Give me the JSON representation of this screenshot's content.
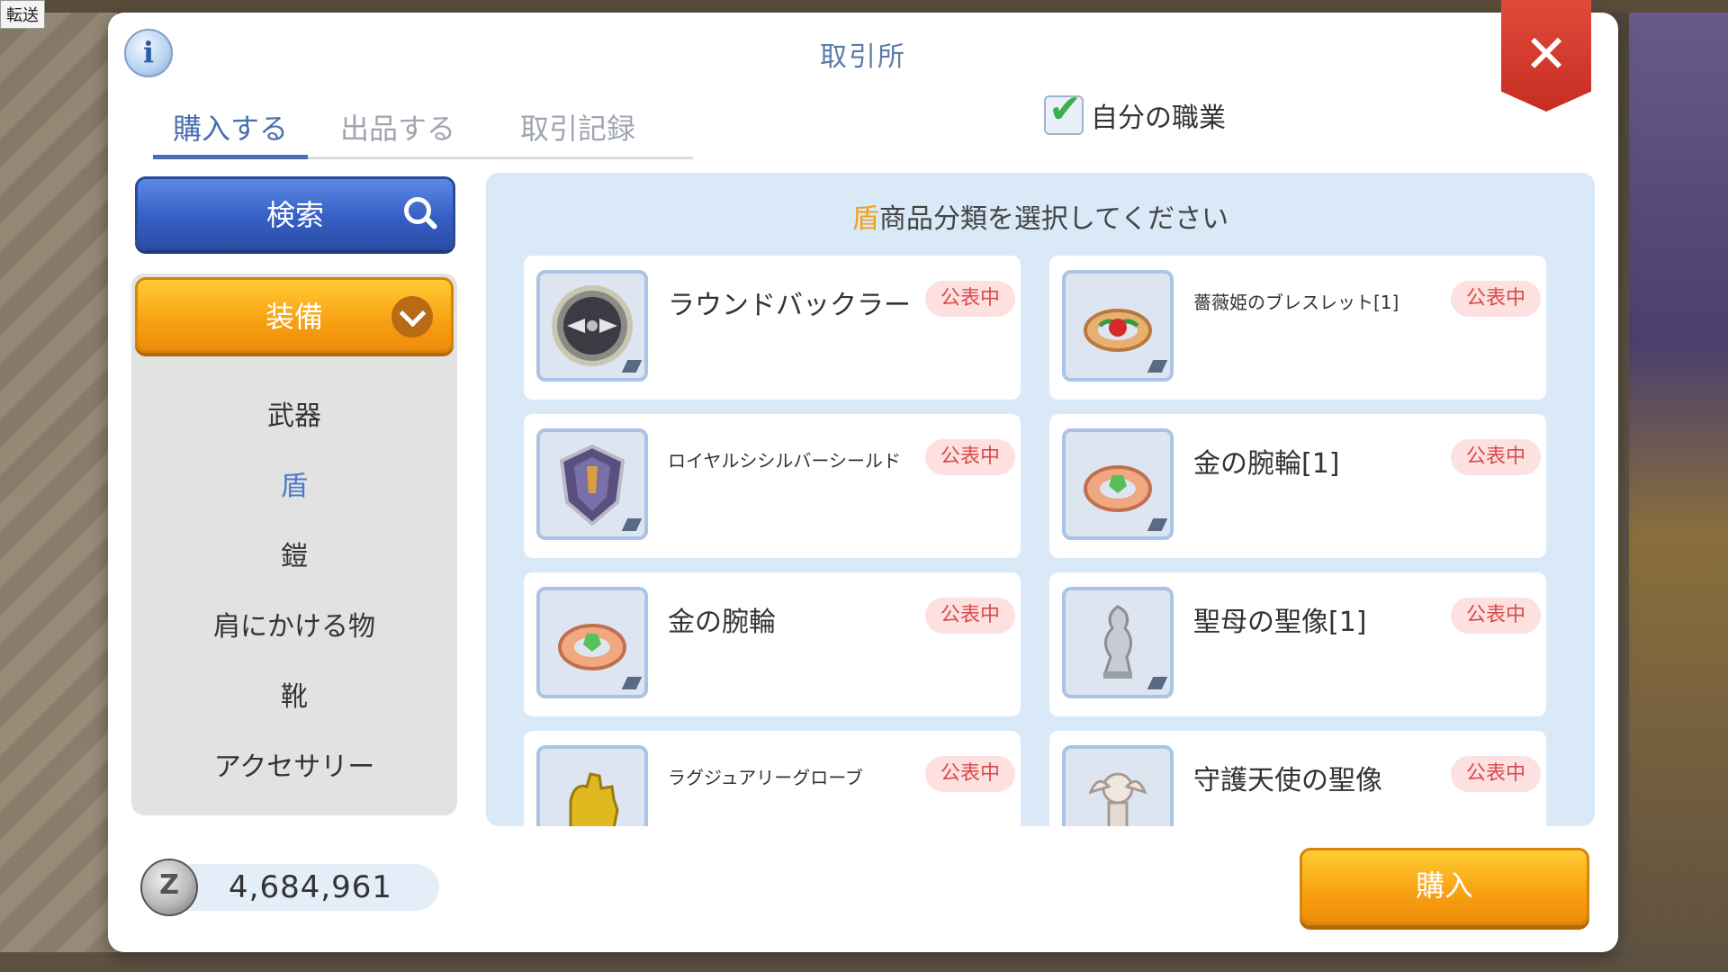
{
  "corner_label": "転送",
  "window": {
    "title": "取引所"
  },
  "tabs": [
    {
      "label": "購入する"
    },
    {
      "label": "出品する"
    },
    {
      "label": "取引記録"
    }
  ],
  "own_class_filter": {
    "label": "自分の職業",
    "checked": true
  },
  "search_button": {
    "label": "検索"
  },
  "category": {
    "selected_label": "装備",
    "subcategories": [
      "武器",
      "盾",
      "鎧",
      "肩にかける物",
      "靴",
      "アクセサリー"
    ],
    "active_index": 1
  },
  "panel": {
    "heading_highlight": "盾",
    "heading_text": "商品分類を選択してください"
  },
  "items": [
    {
      "name": "ラウンドバックラー",
      "status": "公表中",
      "icon": "round-buckler-icon"
    },
    {
      "name": "薔薇姫のブレスレット[1]",
      "status": "公表中",
      "icon": "rose-bracelet-icon"
    },
    {
      "name": "ロイヤルシシルバーシールド",
      "status": "公表中",
      "icon": "royal-silver-shield-icon"
    },
    {
      "name": "金の腕輪[1]",
      "status": "公表中",
      "icon": "gold-bracelet-icon"
    },
    {
      "name": "金の腕輪",
      "status": "公表中",
      "icon": "gold-bracelet-icon"
    },
    {
      "name": "聖母の聖像[1]",
      "status": "公表中",
      "icon": "holy-mother-statue-icon"
    },
    {
      "name": "ラグジュアリーグローブ",
      "status": "公表中",
      "icon": "luxury-glove-icon"
    },
    {
      "name": "守護天使の聖像",
      "status": "公表中",
      "icon": "guardian-angel-statue-icon"
    }
  ],
  "zeny": {
    "amount": "4,684,961",
    "icon": "zeny-coin-icon",
    "icon_letter": "Z"
  },
  "buy_button": {
    "label": "購入"
  },
  "colors": {
    "accent_blue": "#4a6fb0",
    "orange_button": "#f7a012",
    "status_red": "#d84a4a",
    "panel_bg": "#d9e9f7"
  }
}
